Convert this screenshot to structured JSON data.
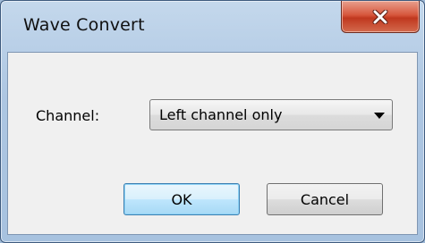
{
  "window": {
    "title": "Wave Convert",
    "close_icon": "close-x-icon"
  },
  "form": {
    "channel_label": "Channel:",
    "channel_value": "Left channel only",
    "dropdown_icon": "chevron-down-icon"
  },
  "buttons": {
    "ok_label": "OK",
    "cancel_label": "Cancel"
  },
  "colors": {
    "titlebar": "#adc6e2",
    "close_button": "#c7442b",
    "client_bg": "#f0f0f0",
    "default_button_border": "#3c7fb1"
  }
}
